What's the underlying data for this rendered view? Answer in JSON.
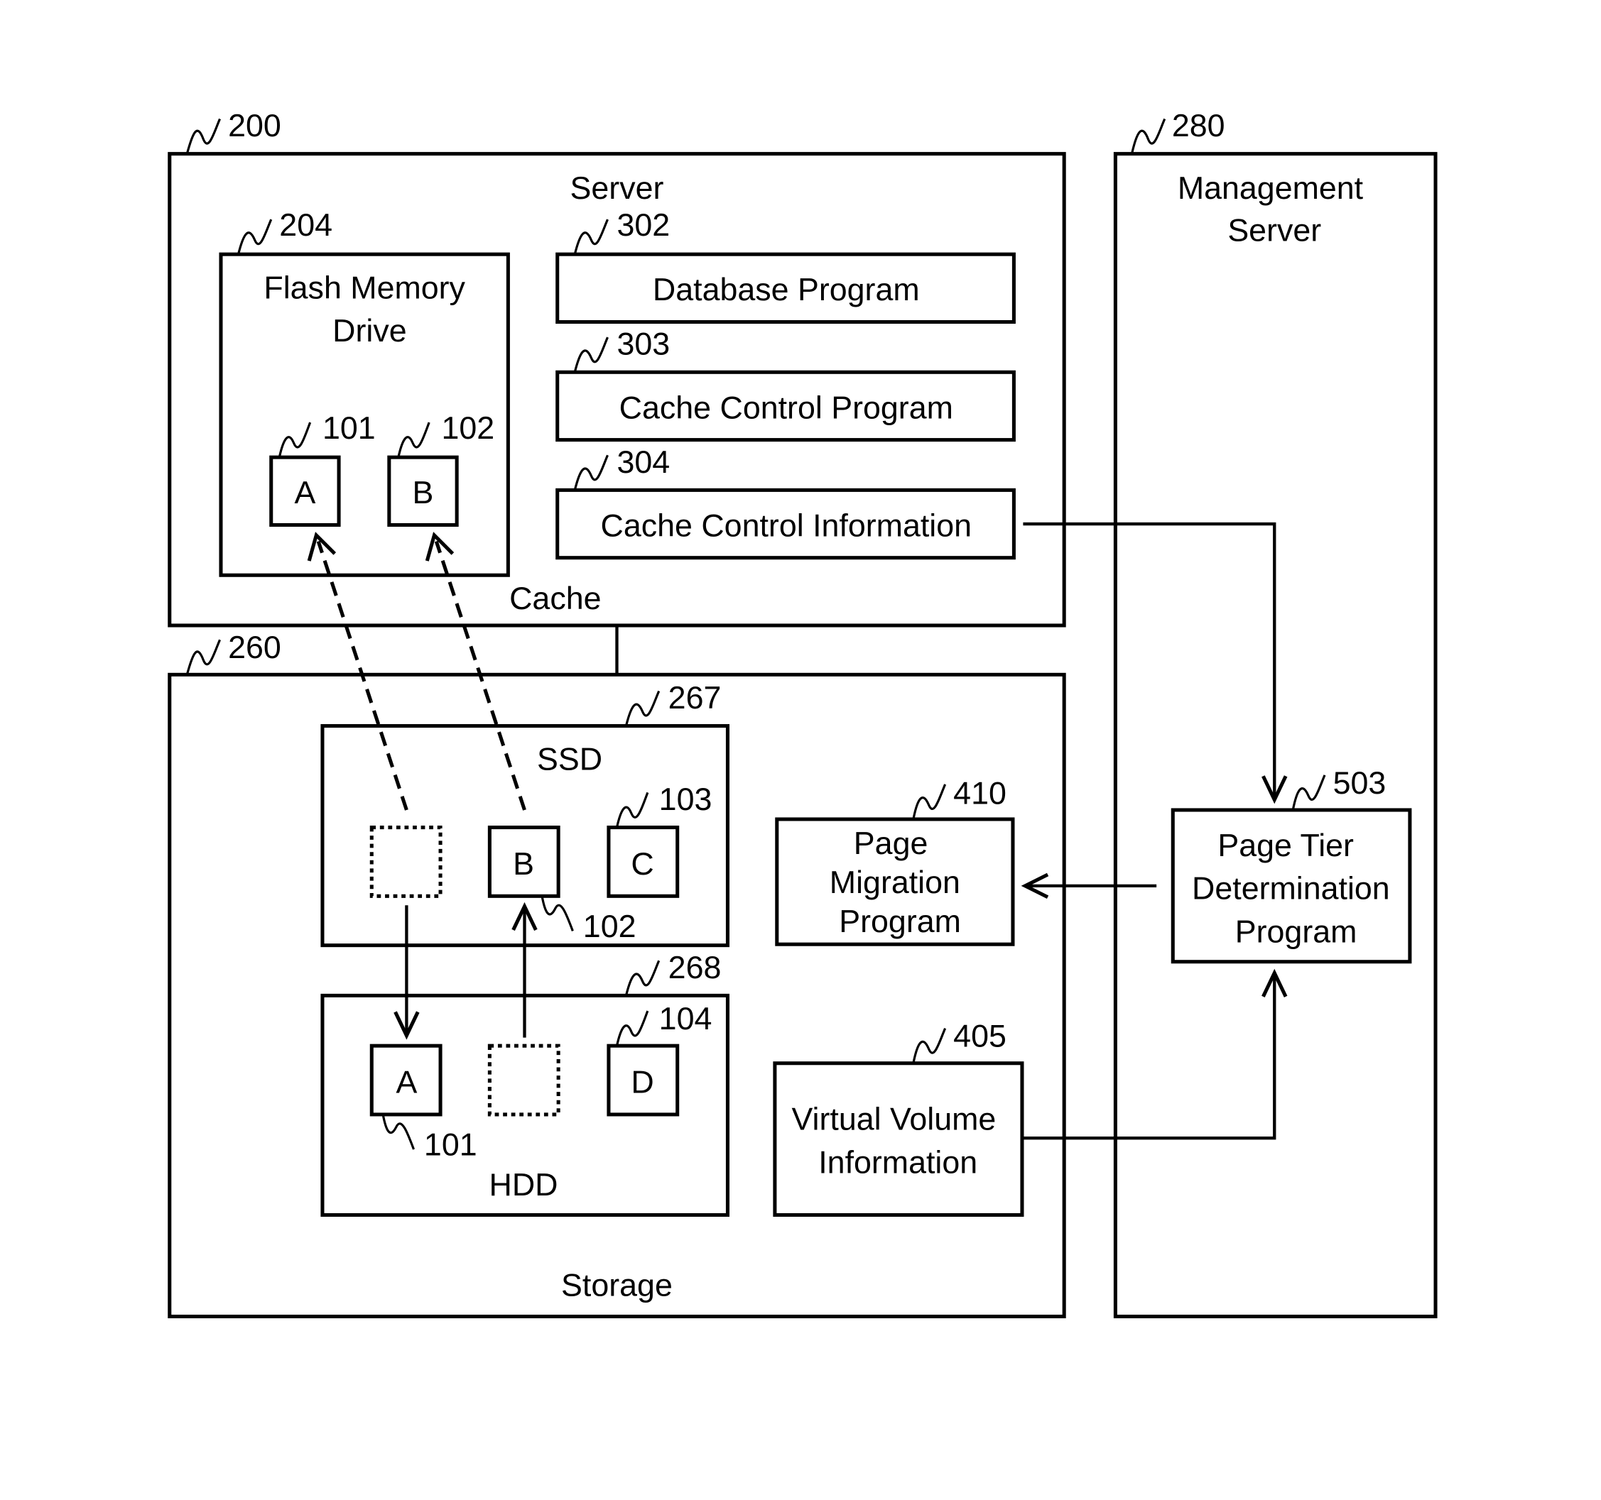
{
  "diagram": {
    "server": {
      "ref": "200",
      "title": "Server",
      "cache_label": "Cache",
      "flash_drive": {
        "ref": "204",
        "title_line1": "Flash Memory",
        "title_line2": "Drive",
        "pages": [
          {
            "ref": "101",
            "label": "A"
          },
          {
            "ref": "102",
            "label": "B"
          }
        ]
      },
      "programs": [
        {
          "ref": "302",
          "label": "Database Program"
        },
        {
          "ref": "303",
          "label": "Cache Control Program"
        },
        {
          "ref": "304",
          "label": "Cache Control Information"
        }
      ]
    },
    "storage": {
      "ref": "260",
      "title": "Storage",
      "ssd": {
        "ref": "267",
        "title": "SSD",
        "pages": [
          {
            "ref": "",
            "label": "",
            "state": "vacated"
          },
          {
            "ref": "102",
            "label": "B"
          },
          {
            "ref": "103",
            "label": "C"
          }
        ]
      },
      "hdd": {
        "ref": "268",
        "title": "HDD",
        "pages": [
          {
            "ref": "101",
            "label": "A"
          },
          {
            "ref": "",
            "label": "",
            "state": "vacated"
          },
          {
            "ref": "104",
            "label": "D"
          }
        ]
      },
      "page_migration": {
        "ref": "410",
        "line1": "Page",
        "line2": "Migration",
        "line3": "Program"
      },
      "virtual_volume": {
        "ref": "405",
        "line1": "Virtual Volume",
        "line2": "Information"
      }
    },
    "management_server": {
      "ref": "280",
      "title_line1": "Management",
      "title_line2": "Server",
      "page_tier": {
        "ref": "503",
        "line1": "Page Tier",
        "line2": "Determination",
        "line3": "Program"
      }
    },
    "connections": [
      {
        "from": "ssd-vacated-slot",
        "to": "flash-page-a",
        "style": "dashed"
      },
      {
        "from": "ssd-page-b",
        "to": "flash-page-b",
        "style": "dashed"
      },
      {
        "from": "ssd-vacated-slot",
        "to": "hdd-page-a",
        "style": "solid"
      },
      {
        "from": "hdd-vacated-slot",
        "to": "ssd-page-b",
        "style": "solid"
      },
      {
        "from": "cache-control-information",
        "to": "page-tier-determination-program",
        "style": "solid"
      },
      {
        "from": "page-tier-determination-program",
        "to": "page-migration-program",
        "style": "solid"
      },
      {
        "from": "virtual-volume-information",
        "to": "page-tier-determination-program",
        "style": "solid"
      },
      {
        "from": "server",
        "to": "storage",
        "style": "solid"
      }
    ]
  }
}
